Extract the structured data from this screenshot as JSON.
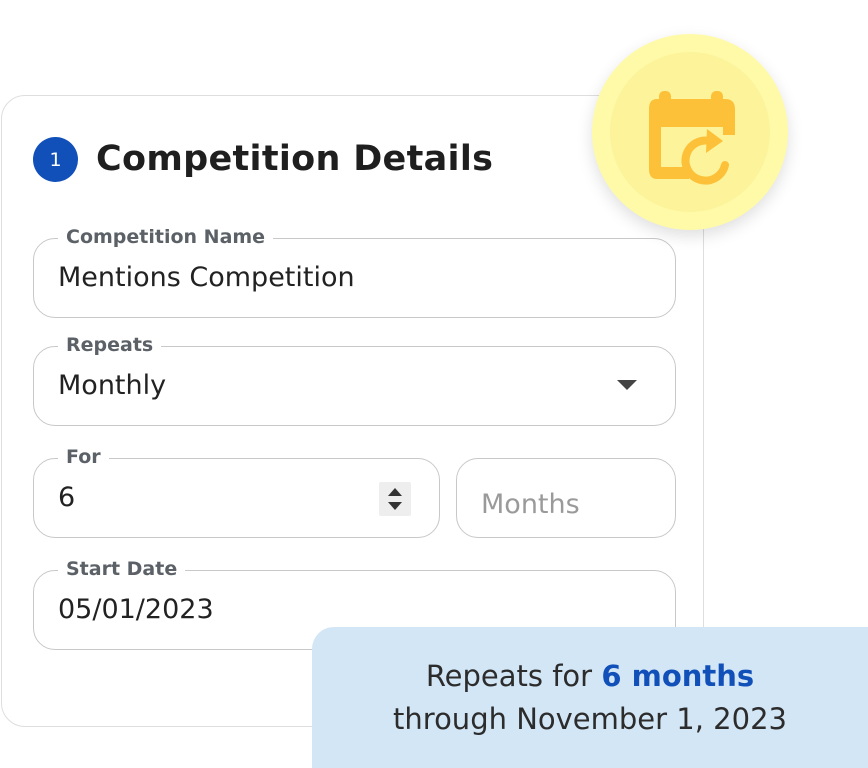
{
  "header": {
    "step_number": "1",
    "title": "Competition Details"
  },
  "form": {
    "competition_name": {
      "label": "Competition Name",
      "value": "Mentions Competition"
    },
    "repeats": {
      "label": "Repeats",
      "value": "Monthly"
    },
    "for": {
      "label": "For",
      "value": "6"
    },
    "unit": {
      "placeholder": "Months"
    },
    "start_date": {
      "label": "Start Date",
      "value": "05/01/2023"
    }
  },
  "summary": {
    "prefix": "Repeats for ",
    "highlight": "6 months",
    "line2": "through November 1, 2023"
  },
  "icons": {
    "badge_icon": "calendar-repeat-icon",
    "dropdown_icon": "chevron-down-icon",
    "stepper_icon": "stepper-icon"
  },
  "colors": {
    "accent_blue": "#1150b9",
    "calendar_icon": "#fcc138",
    "badge_bg": "#fffaa8",
    "summary_bg": "#d3e6f6"
  }
}
